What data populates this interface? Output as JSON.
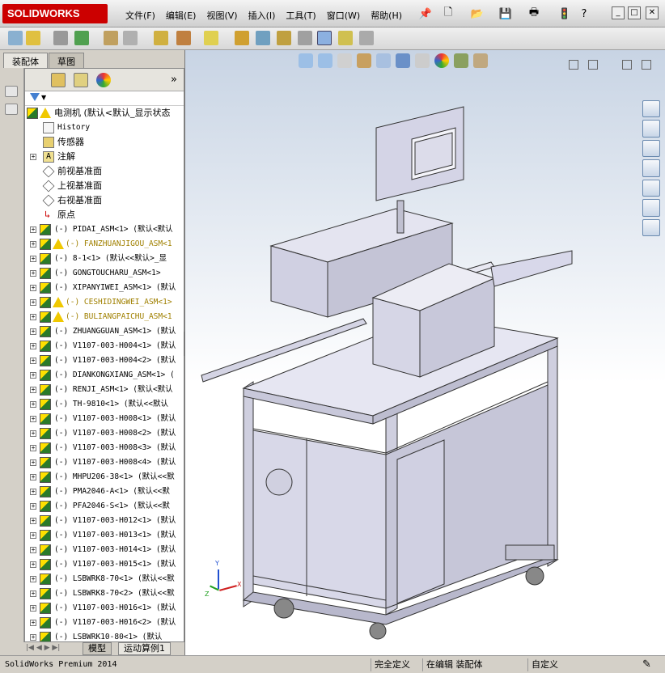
{
  "app": {
    "logo_text": "SOLIDWORKS",
    "status_product": "SolidWorks Premium 2014"
  },
  "menu": [
    "文件(F)",
    "编辑(E)",
    "视图(V)",
    "插入(I)",
    "工具(T)",
    "窗口(W)",
    "帮助(H)"
  ],
  "left_tabs": [
    "装配体",
    "草图"
  ],
  "tree": {
    "root": "电测机  (默认<默认_显示状态",
    "fixed_items": [
      {
        "label": "History",
        "icon": "history-icon"
      },
      {
        "label": "传感器",
        "icon": "sensor-icon"
      },
      {
        "label": "注解",
        "icon": "annotation-icon"
      },
      {
        "label": "前视基准面",
        "icon": "plane-icon"
      },
      {
        "label": "上视基准面",
        "icon": "plane-icon"
      },
      {
        "label": "右视基准面",
        "icon": "plane-icon"
      },
      {
        "label": "原点",
        "icon": "origin-icon"
      }
    ],
    "components": [
      {
        "label": "(-) PIDAI_ASM<1> (默认<默认",
        "warn": false
      },
      {
        "label": "(-) FANZHUANJIGOU_ASM<1",
        "warn": true
      },
      {
        "label": "(-) 8-1<1> (默认<<默认>_显",
        "warn": false
      },
      {
        "label": "(-) GONGTOUCHARU_ASM<1>",
        "warn": false
      },
      {
        "label": "(-) XIPANYIWEI_ASM<1> (默认",
        "warn": false
      },
      {
        "label": "(-) CESHIDINGWEI_ASM<1>",
        "warn": true
      },
      {
        "label": "(-) BULIANGPAICHU_ASM<1",
        "warn": true
      },
      {
        "label": "(-) ZHUANGGUAN_ASM<1> (默认",
        "warn": false
      },
      {
        "label": "(-) V1107-003-H004<1> (默认",
        "warn": false
      },
      {
        "label": "(-) V1107-003-H004<2> (默认",
        "warn": false
      },
      {
        "label": "(-) DIANKONGXIANG_ASM<1> (",
        "warn": false
      },
      {
        "label": "(-) RENJI_ASM<1> (默认<默认",
        "warn": false
      },
      {
        "label": "(-) TH-9810<1> (默认<<默认",
        "warn": false
      },
      {
        "label": "(-) V1107-003-H008<1> (默认",
        "warn": false
      },
      {
        "label": "(-) V1107-003-H008<2> (默认",
        "warn": false
      },
      {
        "label": "(-) V1107-003-H008<3> (默认",
        "warn": false
      },
      {
        "label": "(-) V1107-003-H008<4> (默认",
        "warn": false
      },
      {
        "label": "(-) MHPU206-38<1> (默认<<默",
        "warn": false
      },
      {
        "label": "(-) PMA2046-A<1> (默认<<默",
        "warn": false
      },
      {
        "label": "(-) PFA2046-S<1> (默认<<默",
        "warn": false
      },
      {
        "label": "(-) V1107-003-H012<1> (默认",
        "warn": false
      },
      {
        "label": "(-) V1107-003-H013<1> (默认",
        "warn": false
      },
      {
        "label": "(-) V1107-003-H014<1> (默认",
        "warn": false
      },
      {
        "label": "(-) V1107-003-H015<1> (默认",
        "warn": false
      },
      {
        "label": "(-) LSBWRK8-70<1> (默认<<默",
        "warn": false
      },
      {
        "label": "(-) LSBWRK8-70<2> (默认<<默",
        "warn": false
      },
      {
        "label": "(-) V1107-003-H016<1> (默认",
        "warn": false
      },
      {
        "label": "(-) V1107-003-H016<2> (默认",
        "warn": false
      },
      {
        "label": "(-) LSBWRK10-80<1> (默认",
        "warn": false
      }
    ]
  },
  "bottom_tabs": [
    "模型",
    "运动算例1"
  ],
  "status": [
    "完全定义",
    "在编辑 装配体",
    "自定义"
  ],
  "triad": {
    "x": "X",
    "y": "Y",
    "z": "Z"
  }
}
